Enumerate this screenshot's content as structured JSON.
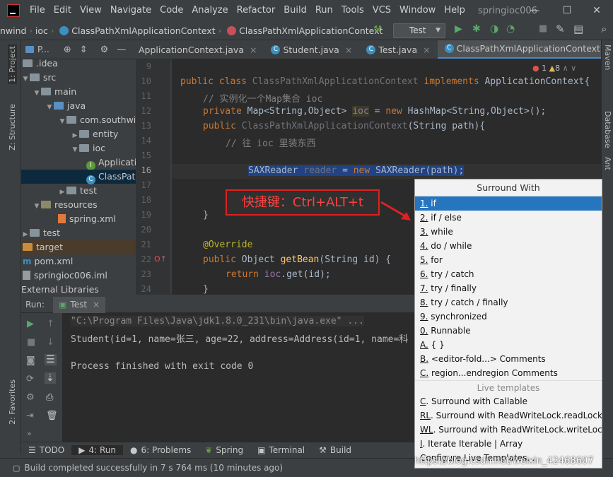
{
  "title_bar": {
    "menus": [
      "File",
      "Edit",
      "View",
      "Navigate",
      "Code",
      "Analyze",
      "Refactor",
      "Build",
      "Run",
      "Tools",
      "VCS",
      "Window",
      "Help"
    ],
    "project": "springioc006"
  },
  "nav_bar": {
    "crumbs": [
      "nwind",
      "ioc",
      "ClassPathXmlApplicationContext",
      "ClassPathXmlApplicationContext"
    ],
    "run_config": "Test"
  },
  "left_stripe": {
    "project": "1: Project",
    "structure": "Z: Structure",
    "favorites": "2: Favorites"
  },
  "right_stripe": {
    "maven": "Maven",
    "database": "Database",
    "ant": "Ant"
  },
  "project_panel": {
    "header": "P...",
    "rows": [
      ".idea",
      "src",
      "main",
      "java",
      "com.southwind",
      "entity",
      "ioc",
      "Applicati",
      "ClassPath",
      "test",
      "resources",
      "spring.xml",
      "test",
      "target",
      "pom.xml",
      "springioc006.iml",
      "External Libraries"
    ]
  },
  "editor_tabs": [
    "ApplicationContext.java",
    "Student.java",
    "Test.java",
    "ClassPathXmlApplicationContext.java"
  ],
  "editor": {
    "line_numbers": [
      "9",
      "10",
      "11",
      "12",
      "13",
      "14",
      "15",
      "16",
      "17",
      "18",
      "19",
      "20",
      "21",
      "22",
      "23",
      "24"
    ],
    "warnings": "1",
    "errors": "8",
    "code": {
      "l10_a": "public class ",
      "l10_b": "ClassPathXmlApplicationContext ",
      "l10_c": "implements ",
      "l10_d": "ApplicationContext{",
      "l11": "// 实例化一个Map集合 ioc",
      "l12_a": "private ",
      "l12_b": "Map<String,Object> ",
      "l12_c": "ioc",
      "l12_d": " = ",
      "l12_e": "new ",
      "l12_f": "HashMap<String,Object>();",
      "l13_a": "public ",
      "l13_b": "ClassPathXmlApplicationContext",
      "l13_c": "(String path){",
      "l14": "// 往 ioc 里装东西",
      "l16_a": "SAXReader ",
      "l16_b": "reader",
      "l16_c": " = ",
      "l16_d": "new ",
      "l16_e": "SAXReader(path);",
      "l19": "}",
      "l21": "@Override",
      "l22_a": "public ",
      "l22_b": "Object ",
      "l22_c": "getBean",
      "l22_d": "(String id) {",
      "l23_a": "return ",
      "l23_b": "ioc",
      "l23_c": ".get(id);",
      "l24": "}"
    }
  },
  "annotation": "快捷键：Ctrl+ALT+t",
  "run_panel": {
    "label": "Run:",
    "tab": "Test",
    "console": [
      "\"C:\\Program Files\\Java\\jdk1.8.0_231\\bin\\java.exe\" ...",
      "Student(id=1, name=张三, age=22, address=Address(id=1, name=科",
      "Process finished with exit code 0"
    ]
  },
  "tool_tabs": [
    "TODO",
    "4: Run",
    "6: Problems",
    "Spring",
    "Terminal",
    "Build"
  ],
  "status": "Build completed successfully in 7 s 764 ms (10 minutes ago)",
  "popup": {
    "title": "Surround With",
    "items": [
      {
        "m": "1.",
        "t": " if"
      },
      {
        "m": "2.",
        "t": " if / else"
      },
      {
        "m": "3.",
        "t": " while"
      },
      {
        "m": "4.",
        "t": " do / while"
      },
      {
        "m": "5.",
        "t": " for"
      },
      {
        "m": "6.",
        "t": " try / catch"
      },
      {
        "m": "7.",
        "t": " try / finally"
      },
      {
        "m": "8.",
        "t": " try / catch / finally"
      },
      {
        "m": "9.",
        "t": " synchronized"
      },
      {
        "m": "0.",
        "t": " Runnable"
      },
      {
        "m": "A.",
        "t": " { }"
      },
      {
        "m": "B.",
        "t": " <editor-fold...> Comments"
      },
      {
        "m": "C.",
        "t": " region...endregion Comments"
      }
    ],
    "live_header": "Live templates",
    "live": [
      {
        "m": "C",
        "t": ". Surround with Callable"
      },
      {
        "m": "RL",
        "t": ". Surround with ReadWriteLock.readLock"
      },
      {
        "m": "WL",
        "t": ". Surround with ReadWriteLock.writeLock"
      },
      {
        "m": "I",
        "t": ". Iterate Iterable | Array"
      },
      {
        "m": "",
        "t": "Configure Live Templates..."
      }
    ]
  },
  "watermark": "https://blog.csdn.net/weixin_42468607",
  "colors": {
    "accent": "#2675bf",
    "keyword": "#cc7832",
    "comment": "#808080",
    "function": "#ffc66d",
    "annotation_red": "#e02020"
  }
}
